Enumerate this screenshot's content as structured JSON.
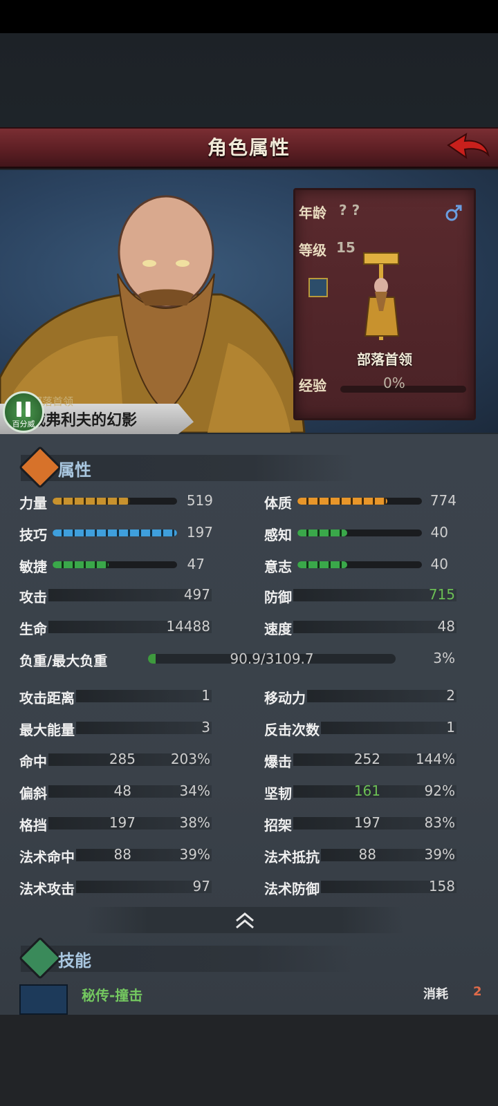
{
  "header": {
    "title": "角色属性"
  },
  "character": {
    "age_label": "年龄",
    "age_value": "? ?",
    "level_label": "等级",
    "level_value": "15",
    "gender": "male-icon",
    "unit_label": "部落首领",
    "exp_label": "经验",
    "exp_value": "0%",
    "exp_fraction": 0,
    "title_small": "部落首领",
    "name": "威弗利夫的幻影",
    "pause_label": "百分威"
  },
  "attributes": {
    "section_title": "属性",
    "bars": [
      {
        "label": "力量",
        "value": "519",
        "color": "#c8922e",
        "fill": 0.62
      },
      {
        "label": "体质",
        "value": "774",
        "color": "#e8962a",
        "fill": 0.72
      },
      {
        "label": "技巧",
        "value": "197",
        "color": "#3f9fdc",
        "fill": 1.0
      },
      {
        "label": "感知",
        "value": "40",
        "color": "#3aa84a",
        "fill": 0.4
      },
      {
        "label": "敏捷",
        "value": "47",
        "color": "#3aa84a",
        "fill": 0.45
      },
      {
        "label": "意志",
        "value": "40",
        "color": "#3aa84a",
        "fill": 0.4
      }
    ],
    "simple": [
      {
        "label": "攻击",
        "value": "497"
      },
      {
        "label": "防御",
        "value": "715"
      },
      {
        "label": "生命",
        "value": "14488"
      },
      {
        "label": "速度",
        "value": "48"
      }
    ],
    "weight": {
      "label": "负重/最大负重",
      "value": "90.9/3109.7",
      "percent": "3%",
      "fraction": 0.03
    },
    "misc": [
      {
        "label": "攻击距离",
        "value": "1"
      },
      {
        "label": "移动力",
        "value": "2"
      },
      {
        "label": "最大能量",
        "value": "3"
      },
      {
        "label": "反击次数",
        "value": "1"
      }
    ],
    "rated": [
      {
        "label": "命中",
        "value": "285",
        "percent": "203%"
      },
      {
        "label": "爆击",
        "value": "252",
        "percent": "144%"
      },
      {
        "label": "偏斜",
        "value": "48",
        "percent": "34%"
      },
      {
        "label": "坚韧",
        "value": "161",
        "percent": "92%"
      },
      {
        "label": "格挡",
        "value": "197",
        "percent": "38%"
      },
      {
        "label": "招架",
        "value": "197",
        "percent": "83%"
      },
      {
        "label": "法术命中",
        "value": "88",
        "percent": "39%"
      },
      {
        "label": "法术抵抗",
        "value": "88",
        "percent": "39%"
      }
    ],
    "magic": [
      {
        "label": "法术攻击",
        "value": "97"
      },
      {
        "label": "法术防御",
        "value": "158"
      }
    ]
  },
  "skills": {
    "section_title": "技能",
    "first_skill_name": "秘传-撞击",
    "cost_label": "消耗",
    "cost_value": "2"
  },
  "colors": {
    "header": "#5e1f24",
    "accent_green": "#6bbf54",
    "attr_icon": "#d7722a",
    "skill_icon": "#3a8a5a"
  }
}
